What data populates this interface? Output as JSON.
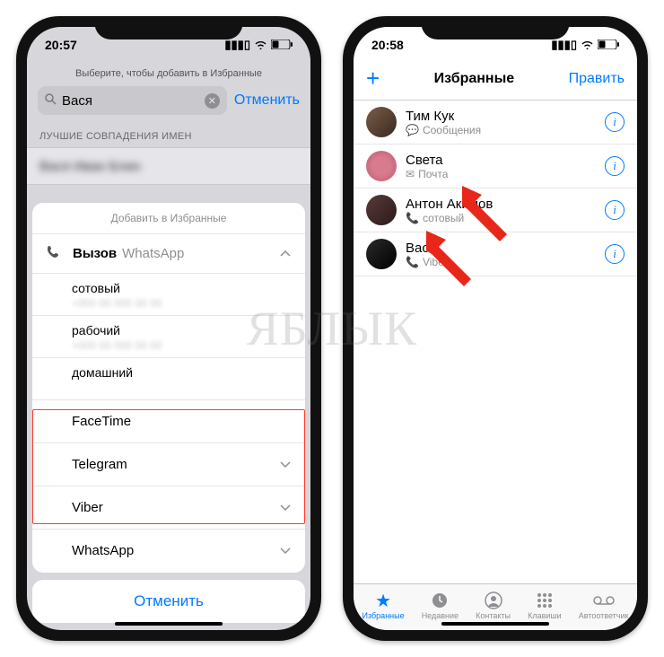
{
  "watermark": "ЯБЛЫК",
  "left": {
    "time": "20:57",
    "header_hint": "Выберите, чтобы добавить в Избранные",
    "search_value": "Вася",
    "cancel_link": "Отменить",
    "section_label": "ЛУЧШИЕ СОВПАДЕНИЯ ИМЕН",
    "sheet_title": "Добавить в Избранные",
    "call_label": "Вызов",
    "call_service": "WhatsApp",
    "phone_types": [
      {
        "label": "сотовый"
      },
      {
        "label": "рабочий"
      },
      {
        "label": "домашний"
      }
    ],
    "services": [
      {
        "label": "FaceTime",
        "has_chevron": false
      },
      {
        "label": "Telegram",
        "has_chevron": true
      },
      {
        "label": "Viber",
        "has_chevron": true
      },
      {
        "label": "WhatsApp",
        "has_chevron": true
      }
    ],
    "cancel_button": "Отменить"
  },
  "right": {
    "time": "20:58",
    "nav_title": "Избранные",
    "nav_edit": "Править",
    "favorites": [
      {
        "name": "Тим Кук",
        "sub": "Сообщения",
        "sub_icon": "message"
      },
      {
        "name": "Света",
        "sub": "Почта",
        "sub_icon": "mail"
      },
      {
        "name": "Антон Акимов",
        "sub": "сотовый",
        "sub_icon": "phone"
      },
      {
        "name": "Вася",
        "sub": "Viber",
        "sub_icon": "phone"
      }
    ],
    "tabs": [
      {
        "label": "Избранные",
        "icon": "star",
        "active": true
      },
      {
        "label": "Недавние",
        "icon": "clock",
        "active": false
      },
      {
        "label": "Контакты",
        "icon": "person",
        "active": false
      },
      {
        "label": "Клавиши",
        "icon": "grid",
        "active": false
      },
      {
        "label": "Автоответчик",
        "icon": "voicemail",
        "active": false
      }
    ]
  }
}
